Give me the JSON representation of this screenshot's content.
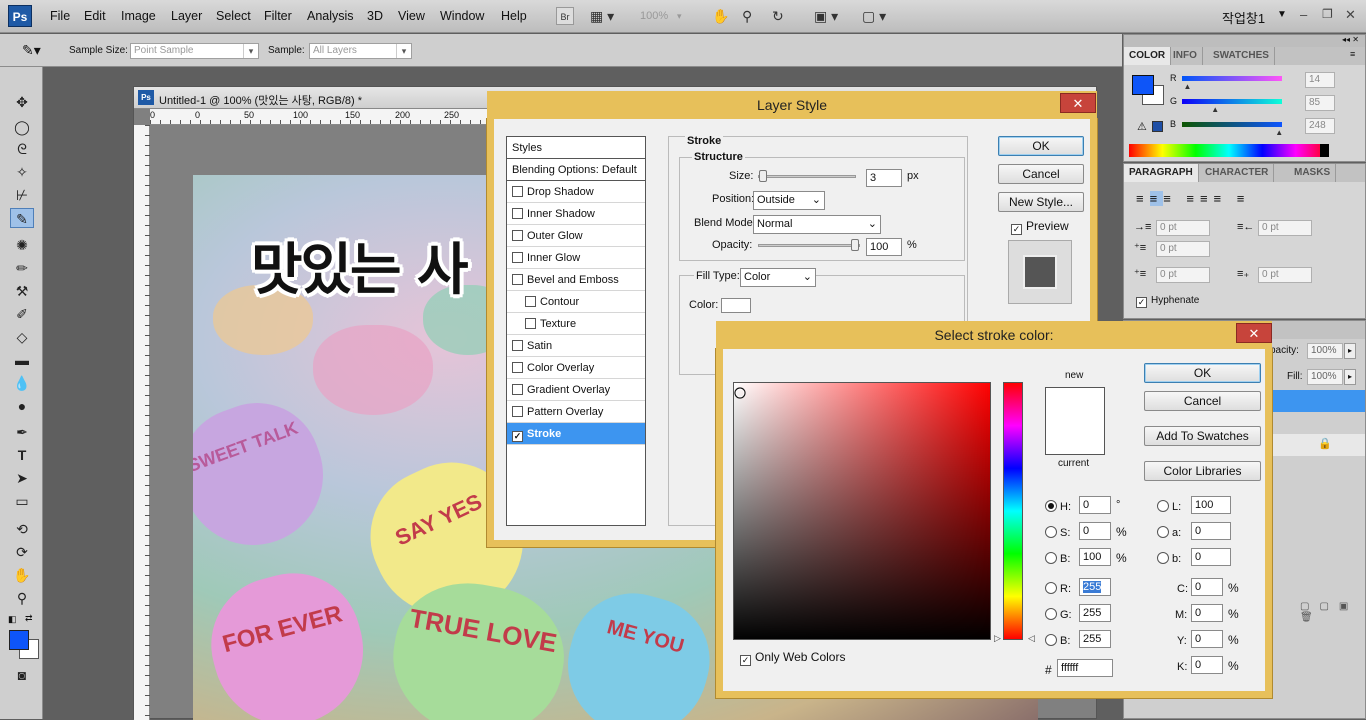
{
  "menubar": {
    "logo": "Ps",
    "items": [
      "File",
      "Edit",
      "Image",
      "Layer",
      "Select",
      "Filter",
      "Analysis",
      "3D",
      "View",
      "Window",
      "Help"
    ],
    "br_label": "Br",
    "zoom": "100%",
    "workspace": "작업창1"
  },
  "options": {
    "sample_size_label": "Sample Size:",
    "sample_size_value": "Point Sample",
    "sample_label": "Sample:",
    "sample_value": "All Layers"
  },
  "document": {
    "title": "Untitled-1 @ 100% (맛있는 사탕, RGB/8) *",
    "ruler_ticks": [
      "0",
      "50",
      "100",
      "150",
      "200",
      "250"
    ],
    "headline": "맛있는 사",
    "candy_texts": [
      "SWEET TALK",
      "SAY YES",
      "TRUE LOVE",
      "ME YOU",
      "FOR EVER"
    ]
  },
  "color_panel": {
    "tabs": [
      "COLOR",
      "INFO",
      "SWATCHES"
    ],
    "r_label": "R",
    "g_label": "G",
    "b_label": "B",
    "r": "14",
    "g": "85",
    "b": "248",
    "r_fraction": 0.055,
    "g_fraction": 0.333,
    "b_fraction": 0.973,
    "foreground": "#0e55f8"
  },
  "paragraph_panel": {
    "tabs": [
      "PARAGRAPH",
      "CHARACTER",
      "MASKS"
    ],
    "indent_left": "0 pt",
    "indent_right": "0 pt",
    "indent_first": "0 pt",
    "space_before": "0 pt",
    "space_after": "0 pt",
    "hyphenate": "Hyphenate"
  },
  "layers_panel": {
    "opacity_label": "pacity:",
    "opacity": "100%",
    "fill_label": "Fill:",
    "fill": "100%"
  },
  "layer_style": {
    "title": "Layer Style",
    "close": "✕",
    "styles_header": "Styles",
    "items": [
      {
        "label": "Blending Options: Default",
        "checkbox": false,
        "checked": false,
        "indent": false,
        "selected": false
      },
      {
        "label": "Drop Shadow",
        "checkbox": true,
        "checked": false,
        "indent": false,
        "selected": false
      },
      {
        "label": "Inner Shadow",
        "checkbox": true,
        "checked": false,
        "indent": false,
        "selected": false
      },
      {
        "label": "Outer Glow",
        "checkbox": true,
        "checked": false,
        "indent": false,
        "selected": false
      },
      {
        "label": "Inner Glow",
        "checkbox": true,
        "checked": false,
        "indent": false,
        "selected": false
      },
      {
        "label": "Bevel and Emboss",
        "checkbox": true,
        "checked": false,
        "indent": false,
        "selected": false
      },
      {
        "label": "Contour",
        "checkbox": true,
        "checked": false,
        "indent": true,
        "selected": false
      },
      {
        "label": "Texture",
        "checkbox": true,
        "checked": false,
        "indent": true,
        "selected": false
      },
      {
        "label": "Satin",
        "checkbox": true,
        "checked": false,
        "indent": false,
        "selected": false
      },
      {
        "label": "Color Overlay",
        "checkbox": true,
        "checked": false,
        "indent": false,
        "selected": false
      },
      {
        "label": "Gradient Overlay",
        "checkbox": true,
        "checked": false,
        "indent": false,
        "selected": false
      },
      {
        "label": "Pattern Overlay",
        "checkbox": true,
        "checked": false,
        "indent": false,
        "selected": false
      },
      {
        "label": "Stroke",
        "checkbox": true,
        "checked": true,
        "indent": false,
        "selected": true
      }
    ],
    "stroke_title": "Stroke",
    "structure_title": "Structure",
    "size_label": "Size:",
    "size": "3",
    "size_unit": "px",
    "position_label": "Position:",
    "position": "Outside",
    "blend_label": "Blend Mode:",
    "blend": "Normal",
    "opacity_label": "Opacity:",
    "opacity": "100",
    "opacity_unit": "%",
    "fill_type_label": "Fill Type:",
    "fill_type": "Color",
    "color_label": "Color:",
    "ok": "OK",
    "cancel": "Cancel",
    "new_style": "New Style...",
    "preview": "Preview"
  },
  "stroke_color": {
    "title": "Select stroke color:",
    "close": "✕",
    "new_label": "new",
    "current_label": "current",
    "ok": "OK",
    "cancel": "Cancel",
    "add_swatches": "Add To Swatches",
    "libraries": "Color Libraries",
    "h_label": "H:",
    "h": "0",
    "h_unit": "°",
    "s_label": "S:",
    "s": "0",
    "s_unit": "%",
    "bb_label": "B:",
    "bb": "100",
    "bb_unit": "%",
    "r_label": "R:",
    "r": "255",
    "g_label": "G:",
    "g": "255",
    "b_label": "B:",
    "b": "255",
    "l_label": "L:",
    "l": "100",
    "a_label": "a:",
    "a": "0",
    "blab_label": "b:",
    "blab": "0",
    "c_label": "C:",
    "c": "0",
    "m_label": "M:",
    "m": "0",
    "y_label": "Y:",
    "y": "0",
    "k_label": "K:",
    "k": "0",
    "pct": "%",
    "hex_label": "#",
    "hex": "ffffff",
    "web_colors": "Only Web Colors"
  }
}
